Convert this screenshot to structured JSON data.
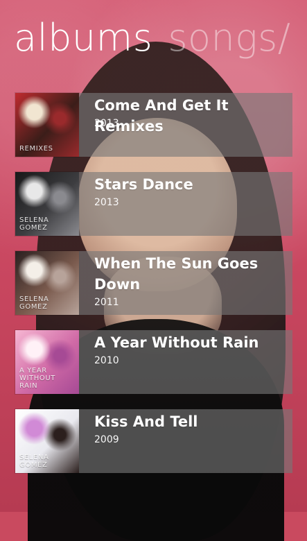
{
  "pivot": {
    "tabs": [
      {
        "label": "albums"
      },
      {
        "label": "songs/"
      }
    ]
  },
  "albums": [
    {
      "title": "Come And Get It Remixes",
      "year": "2013",
      "cover": {
        "palette": [
          "#bf2b2f",
          "#3b1d19",
          "#9a2a2c",
          "#f1e5d1"
        ],
        "text": "REMIXES"
      }
    },
    {
      "title": "Stars Dance",
      "year": "2013",
      "cover": {
        "palette": [
          "#181819",
          "#3d3d40",
          "#8a8a8f",
          "#e8e8e8"
        ],
        "text": "SELENA GOMEZ"
      }
    },
    {
      "title": "When The Sun Goes Down",
      "year": "2011",
      "cover": {
        "palette": [
          "#2b2020",
          "#7a5a4d",
          "#b7a39a",
          "#f4efe8"
        ],
        "text": "SELENA GOMEZ"
      }
    },
    {
      "title": "A Year Without Rain",
      "year": "2010",
      "cover": {
        "palette": [
          "#f6b6d2",
          "#d06aa6",
          "#a64a95",
          "#fff1f7"
        ],
        "text": "A YEAR WITHOUT RAIN"
      }
    },
    {
      "title": "Kiss And Tell",
      "year": "2009",
      "cover": {
        "palette": [
          "#ffffff",
          "#e9e9ef",
          "#2b1f1d",
          "#d18ad6"
        ],
        "text": "SELENA GOMEZ"
      }
    }
  ]
}
